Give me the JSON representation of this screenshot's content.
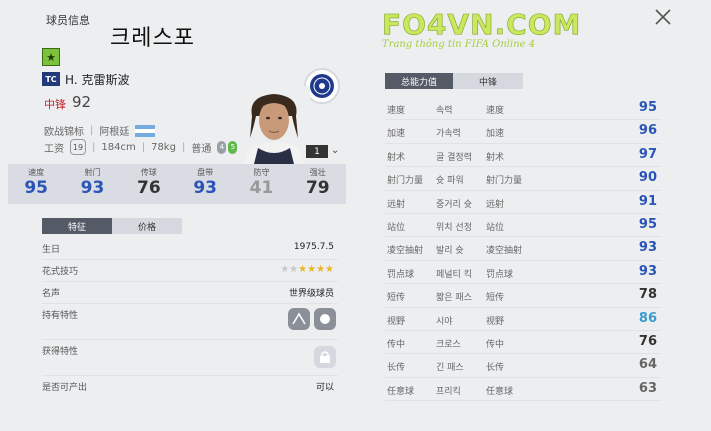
{
  "header": {
    "title": "球员信息",
    "korean_name": "크레스포",
    "watermark_logo": "FO4VN.COM",
    "watermark_sub": "Trang thông tin FIFA Online 4"
  },
  "player": {
    "season_badge": "TC",
    "name": "H. 克雷斯波",
    "position": "中锋",
    "overall": "92",
    "nation_label": "欧战锦标",
    "nation": "阿根廷",
    "age": "19",
    "height": "184cm",
    "weight": "78kg",
    "body": "普通",
    "weak_foot": "4",
    "skill_moves": "5",
    "level": "1",
    "star_icon": "star-icon"
  },
  "stats": [
    {
      "label": "速度",
      "value": "95",
      "color": "#2a54b8"
    },
    {
      "label": "射门",
      "value": "93",
      "color": "#2a54b8"
    },
    {
      "label": "传球",
      "value": "76",
      "color": "#333333"
    },
    {
      "label": "盘带",
      "value": "93",
      "color": "#2a54b8"
    },
    {
      "label": "防守",
      "value": "41",
      "color": "#999999"
    },
    {
      "label": "强壮",
      "value": "79",
      "color": "#333333"
    }
  ],
  "left_tabs": {
    "active": "特征",
    "inactive": "价格"
  },
  "details": {
    "birth_label": "生日",
    "birth_value": "1975.7.5",
    "skill_label": "花式技巧",
    "skill_stars": 4,
    "skill_stars_total": 6,
    "fame_label": "名声",
    "fame_value": "世界级球员",
    "traits_label": "持有特性",
    "acquire_label": "获得特性",
    "sellable_label": "是否可产出",
    "sellable_value": "可以"
  },
  "right_tabs": {
    "active": "总能力值",
    "inactive": "中锋"
  },
  "attributes": [
    {
      "zh": "速度",
      "kr": "속력",
      "zh2": "速度",
      "value": "95",
      "color": "#2a54b8"
    },
    {
      "zh": "加速",
      "kr": "가속력",
      "zh2": "加速",
      "value": "96",
      "color": "#2a54b8"
    },
    {
      "zh": "射术",
      "kr": "골 결정력",
      "zh2": "射术",
      "value": "97",
      "color": "#2a54b8"
    },
    {
      "zh": "射门力量",
      "kr": "슛 파워",
      "zh2": "射门力量",
      "value": "90",
      "color": "#2a54b8"
    },
    {
      "zh": "远射",
      "kr": "중거리 슛",
      "zh2": "远射",
      "value": "91",
      "color": "#2a54b8"
    },
    {
      "zh": "站位",
      "kr": "위치 선정",
      "zh2": "站位",
      "value": "95",
      "color": "#2a54b8"
    },
    {
      "zh": "凌空抽射",
      "kr": "발리 슛",
      "zh2": "凌空抽射",
      "value": "93",
      "color": "#2a54b8"
    },
    {
      "zh": "罚点球",
      "kr": "페널티 킥",
      "zh2": "罚点球",
      "value": "93",
      "color": "#2a54b8"
    },
    {
      "zh": "短传",
      "kr": "짧은 패스",
      "zh2": "短传",
      "value": "78",
      "color": "#333333"
    },
    {
      "zh": "视野",
      "kr": "시야",
      "zh2": "视野",
      "value": "86",
      "color": "#3a9bd0"
    },
    {
      "zh": "传中",
      "kr": "크로스",
      "zh2": "传中",
      "value": "76",
      "color": "#333333"
    },
    {
      "zh": "长传",
      "kr": "긴 패스",
      "zh2": "长传",
      "value": "64",
      "color": "#666666"
    },
    {
      "zh": "任意球",
      "kr": "프리킥",
      "zh2": "任意球",
      "value": "63",
      "color": "#666666"
    }
  ]
}
